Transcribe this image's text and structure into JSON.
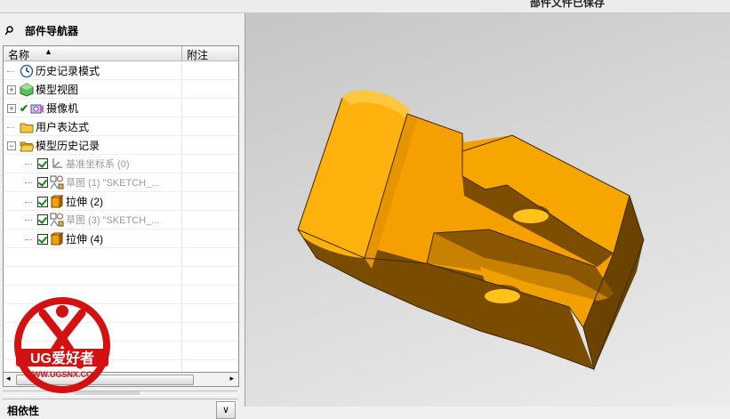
{
  "status": {
    "message": "部件文件已保存"
  },
  "navigator": {
    "title": "部件导航器",
    "columns": {
      "name": "名称",
      "note": "附注"
    },
    "items": [
      {
        "label": "历史记录模式",
        "indent": 0,
        "icon": "clock-icon",
        "expander": null,
        "check": false,
        "gray": false
      },
      {
        "label": "模型视图",
        "indent": 0,
        "icon": "model-views-icon",
        "expander": "+",
        "check": false,
        "gray": false
      },
      {
        "label": "摄像机",
        "indent": 0,
        "icon": "camera-icon",
        "expander": "+",
        "check": true,
        "gray": false
      },
      {
        "label": "用户表达式",
        "indent": 0,
        "icon": "folder-icon",
        "expander": null,
        "check": false,
        "gray": false
      },
      {
        "label": "模型历史记录",
        "indent": 0,
        "icon": "open-folder-icon",
        "expander": "-",
        "check": false,
        "gray": false
      },
      {
        "label": "基准坐标系 (0)",
        "indent": 1,
        "icon": "datum-csys-icon",
        "expander": null,
        "check": true,
        "gray": true
      },
      {
        "label": "草图 (1) \"SKETCH_...",
        "indent": 1,
        "icon": "sketch-icon",
        "expander": null,
        "check": true,
        "gray": true
      },
      {
        "label": "拉伸 (2)",
        "indent": 1,
        "icon": "extrude-icon",
        "expander": null,
        "check": true,
        "gray": false
      },
      {
        "label": "草图 (3) \"SKETCH_...",
        "indent": 1,
        "icon": "sketch-icon",
        "expander": null,
        "check": true,
        "gray": true
      },
      {
        "label": "拉伸 (4)",
        "indent": 1,
        "icon": "extrude-icon",
        "expander": null,
        "check": true,
        "gray": false
      }
    ],
    "empty_rows": 7,
    "dependency_label": "相依性",
    "dependency_button": "∨"
  },
  "watermark": {
    "brand": "UG爱好者",
    "url": "WWW.UGSNX.COM"
  },
  "colors": {
    "part_top": "#f5a000",
    "part_side": "#a86a00",
    "part_dark": "#6b4300",
    "hole": "#ffc21a",
    "check": "#0a8a0a"
  }
}
